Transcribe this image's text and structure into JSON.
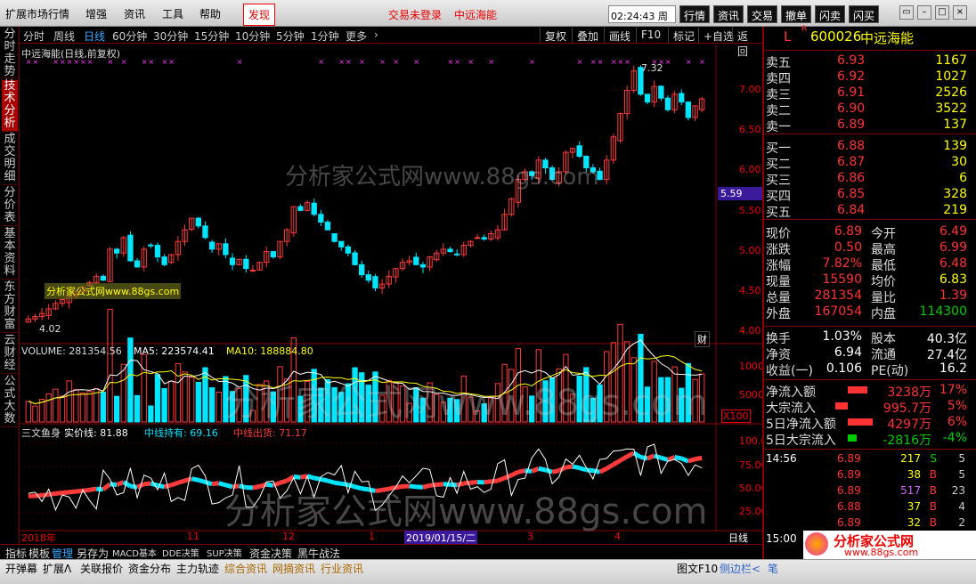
{
  "menubar": {
    "items": [
      "扩展市场行情",
      "增强",
      "资讯",
      "工具",
      "帮助",
      "发现"
    ],
    "status": "交易未登录",
    "stock_title": "中远海能",
    "time": "02:24:43",
    "weekday": "周五",
    "trade_buttons": [
      "行情",
      "资讯",
      "交易",
      "撤单",
      "闪卖",
      "闪买"
    ]
  },
  "periodbar": {
    "periods": [
      "分时",
      "周线",
      "日线",
      "60分钟",
      "30分钟",
      "15分钟",
      "10分钟",
      "5分钟",
      "1分钟",
      "更多"
    ],
    "selected": "日线",
    "tools": [
      "复权",
      "叠加",
      "画线",
      "F10",
      "标记",
      "+自选",
      "返回"
    ]
  },
  "lefttabs": [
    "分时走势",
    "技术分析",
    "成交明细",
    "分价表",
    "基本资料",
    "东方财富",
    "云财经",
    "公式大数"
  ],
  "chart": {
    "title": "中远海能(日线,前复权)",
    "price_axis": [
      "7.00",
      "6.50",
      "6.00",
      "5.50",
      "5.00",
      "4.50",
      "4.00"
    ],
    "current_price_tag": "5.59",
    "high_mark": "7.32",
    "low_mark": "4.02",
    "badge": "财",
    "volume_label": "VOLUME: 281354.56",
    "ma5_label": "MA5: 223574.41",
    "ma10_label": "MA10: 188884.80",
    "volume_axis": [
      "10000",
      "5000"
    ],
    "volume_unit": "X100",
    "indicator_name": "三文鱼身",
    "indicator_l1": "实价线: 81.88",
    "indicator_l2": "中线持有: 69.16",
    "indicator_l3": "中线出货: 71.17",
    "indicator_axis": [
      "100.0",
      "75.00",
      "50.00",
      "25.00"
    ],
    "date_labels": [
      "2018年",
      "11",
      "12",
      "1",
      "2019/01/15/二",
      "3",
      "4"
    ],
    "period_tag": "日线",
    "watermark": "分析家公式网www.88gs.com",
    "watermark_small": "分析家公式网www.88gs.com",
    "colors": {
      "up": "#ff3b3b",
      "down": "#00e5ff",
      "ma5": "#ffffff",
      "ma10": "#ffff00",
      "purple": "#ff33ff"
    }
  },
  "chart_data": {
    "type": "candlestick",
    "price_ylim": [
      3.8,
      7.5
    ],
    "closes": [
      4.05,
      4.08,
      4.12,
      4.18,
      4.25,
      4.3,
      4.35,
      4.4,
      4.46,
      4.52,
      4.6,
      4.55,
      4.95,
      4.9,
      5.1,
      4.8,
      4.72,
      4.95,
      5.0,
      4.85,
      4.75,
      4.88,
      5.05,
      5.2,
      5.35,
      5.25,
      5.1,
      4.95,
      5.02,
      4.88,
      4.75,
      4.82,
      4.7,
      4.68,
      4.78,
      4.92,
      4.85,
      5.05,
      5.2,
      5.5,
      5.45,
      5.55,
      5.4,
      5.3,
      5.2,
      5.05,
      4.98,
      4.9,
      4.75,
      4.62,
      4.55,
      4.45,
      4.5,
      4.6,
      4.7,
      4.78,
      4.8,
      4.75,
      4.72,
      4.85,
      4.9,
      4.95,
      4.92,
      4.88,
      5.0,
      5.05,
      5.1,
      5.08,
      5.15,
      5.2,
      5.4,
      5.6,
      5.85,
      5.95,
      5.9,
      6.1,
      6.0,
      5.85,
      5.95,
      6.2,
      6.25,
      6.15,
      6.0,
      5.95,
      5.85,
      6.1,
      6.4,
      6.7,
      7.0,
      7.25,
      6.95,
      6.85,
      7.05,
      6.9,
      6.75,
      6.95,
      6.85,
      6.65,
      6.8,
      6.89
    ]
  },
  "rightpanel": {
    "code": "600026",
    "name": "中远海能",
    "asks": [
      {
        "l": "卖五",
        "p": "6.93",
        "v": "1167"
      },
      {
        "l": "卖四",
        "p": "6.92",
        "v": "1027"
      },
      {
        "l": "卖三",
        "p": "6.91",
        "v": "2526"
      },
      {
        "l": "卖二",
        "p": "6.90",
        "v": "3522"
      },
      {
        "l": "卖一",
        "p": "6.89",
        "v": "137"
      }
    ],
    "bids": [
      {
        "l": "买一",
        "p": "6.88",
        "v": "139"
      },
      {
        "l": "买二",
        "p": "6.87",
        "v": "30"
      },
      {
        "l": "买三",
        "p": "6.86",
        "v": "6"
      },
      {
        "l": "买四",
        "p": "6.85",
        "v": "328"
      },
      {
        "l": "买五",
        "p": "6.84",
        "v": "219"
      }
    ],
    "stats": [
      {
        "a": "现价",
        "av": "6.89",
        "b": "今开",
        "bv": "6.49"
      },
      {
        "a": "涨跌",
        "av": "0.50",
        "b": "最高",
        "bv": "6.99"
      },
      {
        "a": "涨幅",
        "av": "7.82%",
        "b": "最低",
        "bv": "6.48"
      },
      {
        "a": "现量",
        "av": "15590",
        "b": "均价",
        "bv": "6.83"
      },
      {
        "a": "总量",
        "av": "281354",
        "b": "量比",
        "bv": "1.39"
      },
      {
        "a": "外盘",
        "av": "167054",
        "b": "内盘",
        "bv": "114300"
      }
    ],
    "stats2": [
      {
        "a": "换手",
        "av": "1.03%",
        "b": "股本",
        "bv": "40.3亿"
      },
      {
        "a": "净资",
        "av": "6.94",
        "b": "流通",
        "bv": "27.4亿"
      },
      {
        "a": "收益(一)",
        "av": "0.106",
        "b": "PE(动)",
        "bv": "16.2"
      }
    ],
    "flows": [
      {
        "l": "净流入额",
        "v": "3238万",
        "p": "17%"
      },
      {
        "l": "大宗流入",
        "v": "995.7万",
        "p": "5%"
      },
      {
        "l": "5日净流入额",
        "v": "4297万",
        "p": "6%"
      },
      {
        "l": "5日大宗流入",
        "v": "-2816万",
        "p": "-4%"
      }
    ],
    "ticks": [
      {
        "t": "14:56",
        "p": "6.89",
        "v": "217",
        "s": "S",
        "n": "5"
      },
      {
        "t": "",
        "p": "6.89",
        "v": "38",
        "s": "B",
        "n": "5"
      },
      {
        "t": "",
        "p": "6.89",
        "v": "517",
        "s": "B",
        "n": "23"
      },
      {
        "t": "",
        "p": "6.88",
        "v": "37",
        "s": "B",
        "n": "4"
      },
      {
        "t": "",
        "p": "6.89",
        "v": "32",
        "s": "B",
        "n": "2"
      },
      {
        "t": "15:00",
        "p": "",
        "v": "",
        "s": "",
        "n": ""
      }
    ],
    "logo": "分析家公式网",
    "logo_url": "www.88gs.com"
  },
  "bottomtabs": [
    "指标",
    "模板",
    "管理",
    "另存为",
    "MACD基本",
    "DDE决策",
    "SUP决策",
    "资金决策",
    "黑牛战法"
  ],
  "statusbar": [
    "开弹幕",
    "扩展ᐱ",
    "关联报价",
    "资金分布",
    "主力轨迹",
    "综合资讯",
    "网摘资讯",
    "行业资讯",
    "图文F10",
    "侧边栏<",
    "笔"
  ]
}
